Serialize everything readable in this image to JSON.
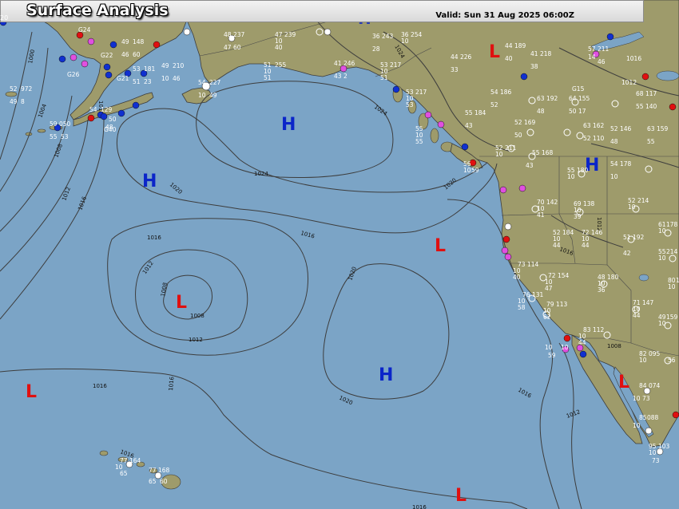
{
  "header": {
    "title": "Surface Analysis",
    "valid": "Valid: Sun 31 Aug 2025 06:00Z",
    "corner_left": "20"
  },
  "colors": {
    "ocean": "#7ba4c6",
    "land": "#9e9b6b",
    "isobar": "#3d3d3d",
    "high": "#0b25c9",
    "low": "#e01010"
  },
  "pressure_centers": [
    {
      "type": "H",
      "label": "H"
    },
    {
      "type": "H",
      "label": "H"
    },
    {
      "type": "H",
      "label": "H"
    },
    {
      "type": "H",
      "label": "H"
    },
    {
      "type": "L",
      "label": "L"
    },
    {
      "type": "L",
      "label": "L"
    },
    {
      "type": "L",
      "label": "L"
    },
    {
      "type": "L",
      "label": "L"
    },
    {
      "type": "L",
      "label": "L"
    },
    {
      "type": "L",
      "label": "L"
    }
  ],
  "isobar_labels": [
    "1024",
    "1024",
    "1020",
    "1020",
    "1016",
    "1016",
    "1016",
    "1016",
    "1016",
    "1012",
    "1012",
    "1012",
    "1008",
    "1008",
    "1012",
    "1016",
    "1016",
    "1008",
    "1004",
    "1000",
    "1008",
    "1012",
    "1024",
    "1020",
    "1016",
    "1020",
    "1012",
    "1016"
  ],
  "stations": [
    {
      "temp": "52",
      "pres": "972",
      "dew": "49",
      "wind": "8"
    },
    {
      "temp": "49",
      "pres": "148",
      "dew": "46",
      "wind": "60"
    },
    {
      "temp": "53",
      "pres": "181",
      "dew": "51",
      "wind": "23"
    },
    {
      "temp": "49",
      "pres": "210",
      "dew": "10",
      "wind": "46"
    },
    {
      "temp": "54",
      "pres": "129",
      "dew": "50",
      "wind": "48"
    },
    {
      "temp": "59",
      "pres": "050",
      "dew": "55",
      "wind": "53"
    },
    {
      "temp": "54",
      "pres": "227",
      "dew": "10",
      "wind": "49"
    },
    {
      "temp": "51",
      "pres": "255",
      "dew": "10",
      "wind": "51"
    },
    {
      "temp": "48",
      "pres": "237",
      "dew": "47",
      "wind": "60"
    },
    {
      "temp": "47",
      "pres": "239",
      "dew": "10",
      "wind": "40"
    },
    {
      "temp": "36",
      "pres": "243",
      "dew": "28",
      "wind": ""
    },
    {
      "temp": "36",
      "pres": "254",
      "dew": "10",
      "wind": ""
    },
    {
      "temp": "41",
      "pres": "246",
      "dew": "43",
      "wind": "2"
    },
    {
      "temp": "53",
      "pres": "217",
      "dew": "10",
      "wind": "51"
    },
    {
      "temp": "53",
      "pres": "217",
      "dew": "10",
      "wind": "53"
    },
    {
      "temp": "44",
      "pres": "226",
      "dew": "33",
      "wind": ""
    },
    {
      "temp": "44",
      "pres": "189",
      "dew": "40",
      "wind": ""
    },
    {
      "temp": "41",
      "pres": "218",
      "dew": "38",
      "wind": ""
    },
    {
      "temp": "57",
      "pres": "211",
      "dew": "14",
      "wind": "46"
    },
    {
      "temp": "63",
      "pres": "192",
      "dew": "48",
      "wind": ""
    },
    {
      "temp": "64",
      "pres": "155",
      "dew": "50",
      "wind": "17"
    },
    {
      "temp": "54",
      "pres": "186",
      "dew": "52",
      "wind": ""
    },
    {
      "temp": "55",
      "pres": "184",
      "dew": "43",
      "wind": ""
    },
    {
      "temp": "52",
      "pres": "169",
      "dew": "50",
      "wind": ""
    },
    {
      "temp": "63",
      "pres": "162",
      "dew": "52",
      "wind": "110"
    },
    {
      "temp": "52",
      "pres": "146",
      "dew": "48",
      "wind": ""
    },
    {
      "temp": "63",
      "pres": "159",
      "dew": "55",
      "wind": ""
    },
    {
      "temp": "68",
      "pres": "117",
      "dew": "55",
      "wind": "140"
    },
    {
      "temp": "52",
      "pres": "211",
      "dew": "10",
      "wind": ""
    },
    {
      "temp": "55",
      "pres": "168",
      "dew": "43",
      "wind": ""
    },
    {
      "temp": "54",
      "pres": "178",
      "dew": "10",
      "wind": ""
    },
    {
      "temp": "55",
      "pres": "180",
      "dew": "10",
      "wind": ""
    },
    {
      "temp": "70",
      "pres": "142",
      "dew": "10",
      "wind": "41"
    },
    {
      "temp": "69",
      "pres": "138",
      "dew": "10",
      "wind": "39"
    },
    {
      "temp": "52",
      "pres": "214",
      "dew": "10",
      "wind": ""
    },
    {
      "temp": "61",
      "pres": "178",
      "dew": "10",
      "wind": ""
    },
    {
      "temp": "52",
      "pres": "184",
      "dew": "10",
      "wind": "44"
    },
    {
      "temp": "72",
      "pres": "146",
      "dew": "10",
      "wind": "44"
    },
    {
      "temp": "51",
      "pres": "192",
      "dew": "42",
      "wind": ""
    },
    {
      "temp": "55",
      "pres": "214",
      "dew": "10",
      "wind": ""
    },
    {
      "temp": "73",
      "pres": "114",
      "dew": "10",
      "wind": "40"
    },
    {
      "temp": "72",
      "pres": "154",
      "dew": "10",
      "wind": "47"
    },
    {
      "temp": "76",
      "pres": "131",
      "dew": "10",
      "wind": "58"
    },
    {
      "temp": "79",
      "pres": "113",
      "dew": "10",
      "wind": "62"
    },
    {
      "temp": "48",
      "pres": "180",
      "dew": "10",
      "wind": "36"
    },
    {
      "temp": "71",
      "pres": "147",
      "dew": "10",
      "wind": "44"
    },
    {
      "temp": "80",
      "pres": "107",
      "dew": "10",
      "wind": ""
    },
    {
      "temp": "49",
      "pres": "159",
      "dew": "10",
      "wind": ""
    },
    {
      "temp": "83",
      "pres": "112",
      "dew": "10",
      "wind": "44"
    },
    {
      "temp": "82",
      "pres": "095",
      "dew": "10",
      "wind": "56"
    },
    {
      "temp": "84",
      "pres": "074",
      "dew": "10",
      "wind": "73"
    },
    {
      "temp": "85",
      "pres": "088",
      "dew": "10",
      "wind": ""
    },
    {
      "temp": "95",
      "pres": "103",
      "dew": "10",
      "wind": "73"
    },
    {
      "temp": "77",
      "pres": "164",
      "dew": "10",
      "wind": "65"
    },
    {
      "temp": "77",
      "pres": "168",
      "dew": "65",
      "wind": "60"
    },
    {
      "temp": "10",
      "pres": "59",
      "dew": "10",
      "wind": ""
    },
    {
      "temp": "56",
      "pres": "",
      "dew": "10",
      "wind": "59"
    },
    {
      "temp": "55",
      "pres": "",
      "dew": "10",
      "wind": "55"
    },
    {
      "temp": "1016",
      "pres": "",
      "dew": "1012",
      "wind": ""
    }
  ],
  "station_ids": [
    "G24",
    "G22",
    "G26",
    "G21",
    "G40",
    "G15"
  ]
}
